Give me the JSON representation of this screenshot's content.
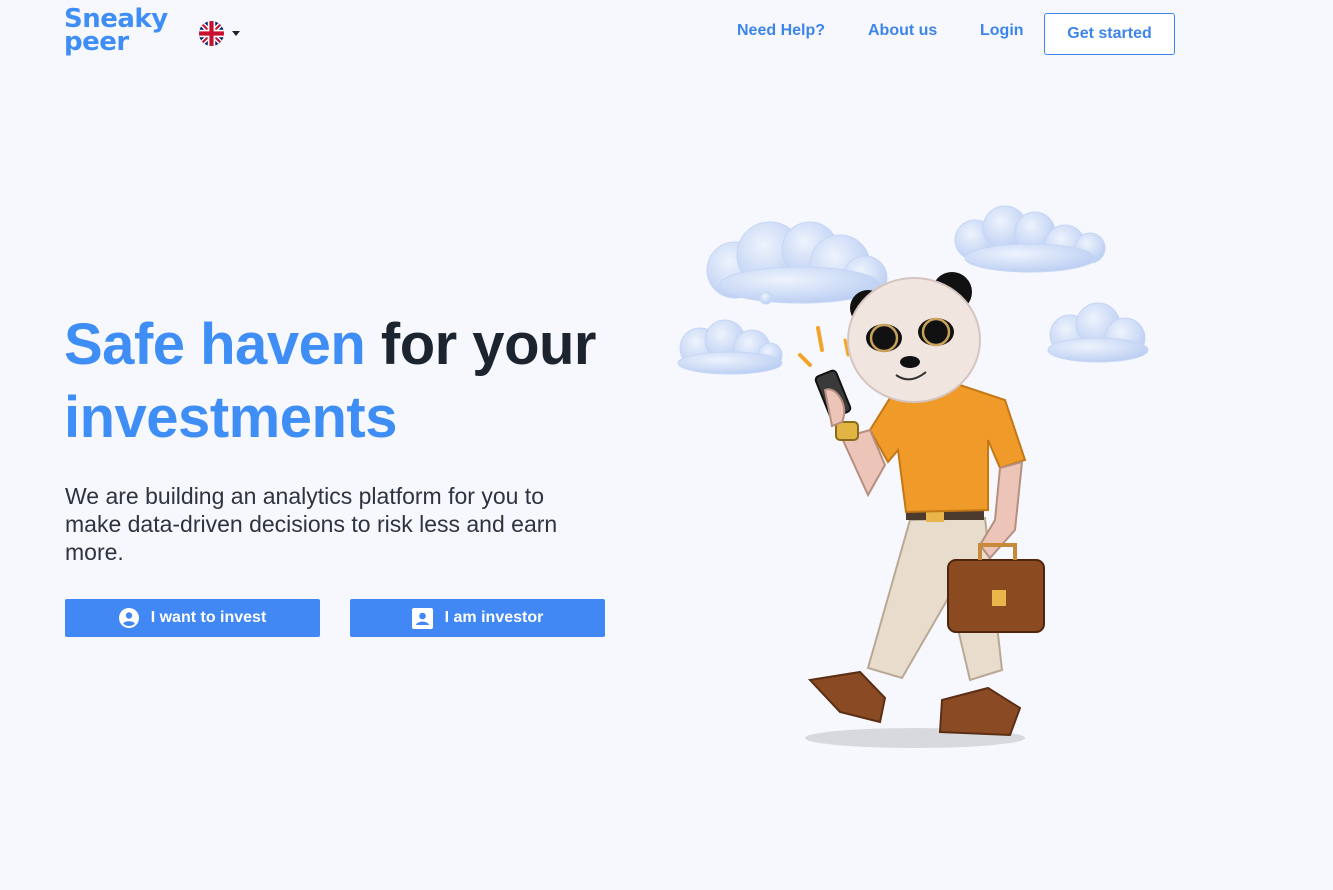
{
  "brand": {
    "line1": "Sneaky",
    "line2": "peer"
  },
  "language": {
    "icon": "uk-flag-icon"
  },
  "nav": {
    "help": "Need Help?",
    "about": "About us",
    "login": "Login",
    "get_started": "Get started"
  },
  "hero": {
    "title_accent": "Safe haven",
    "title_rest": " for your",
    "title_line2": "investments",
    "subtitle": "We are building an analytics platform for you to make data-driven decisions to risk less and earn more."
  },
  "actions": {
    "invest": {
      "label": "I want to invest",
      "icon": "user-circle-icon"
    },
    "investor": {
      "label": "I am investor",
      "icon": "contact-card-icon"
    }
  },
  "colors": {
    "accent": "#3f8ef5",
    "button": "#4188f4",
    "background": "#f7f8fd"
  }
}
